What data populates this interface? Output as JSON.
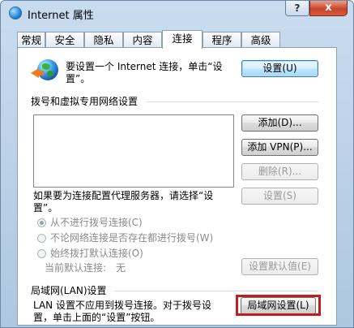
{
  "window": {
    "title": "Internet 属性",
    "help": "?",
    "close": "x"
  },
  "tabs": [
    "常规",
    "安全",
    "隐私",
    "内容",
    "连接",
    "程序",
    "高级"
  ],
  "active_tab": "连接",
  "setup": {
    "text_line1": "要设置一个 Internet 连接，单击“设",
    "text_line2": "置”。",
    "button": "设置(U)"
  },
  "dialup": {
    "heading": "拨号和虚拟专用网络设置",
    "add": "添加(D)...",
    "add_vpn": "添加 VPN(P)...",
    "remove": "删除(R)...",
    "settings": "设置(S)",
    "proxy_line1": "如果要为连接配置代理服务器，请选择“设",
    "proxy_line2": "置”。",
    "options": [
      "从不进行拨号连接(C)",
      "不论网络连接是否存在都进行拨号(W)",
      "始终拨打默认连接(O)"
    ],
    "current_default_label": "当前默认连接:",
    "current_default_value": "无",
    "set_default": "设置默认值(E)"
  },
  "lan": {
    "heading": "局域网(LAN)设置",
    "text_line1": "LAN 设置不应用到拨号连接。对于拨号设",
    "text_line2": "置，单击上面的“设置”按钮。",
    "button": "局域网设置(L)"
  },
  "colors": {
    "highlight": "#c21c1c",
    "close_button": "#c7452c"
  }
}
